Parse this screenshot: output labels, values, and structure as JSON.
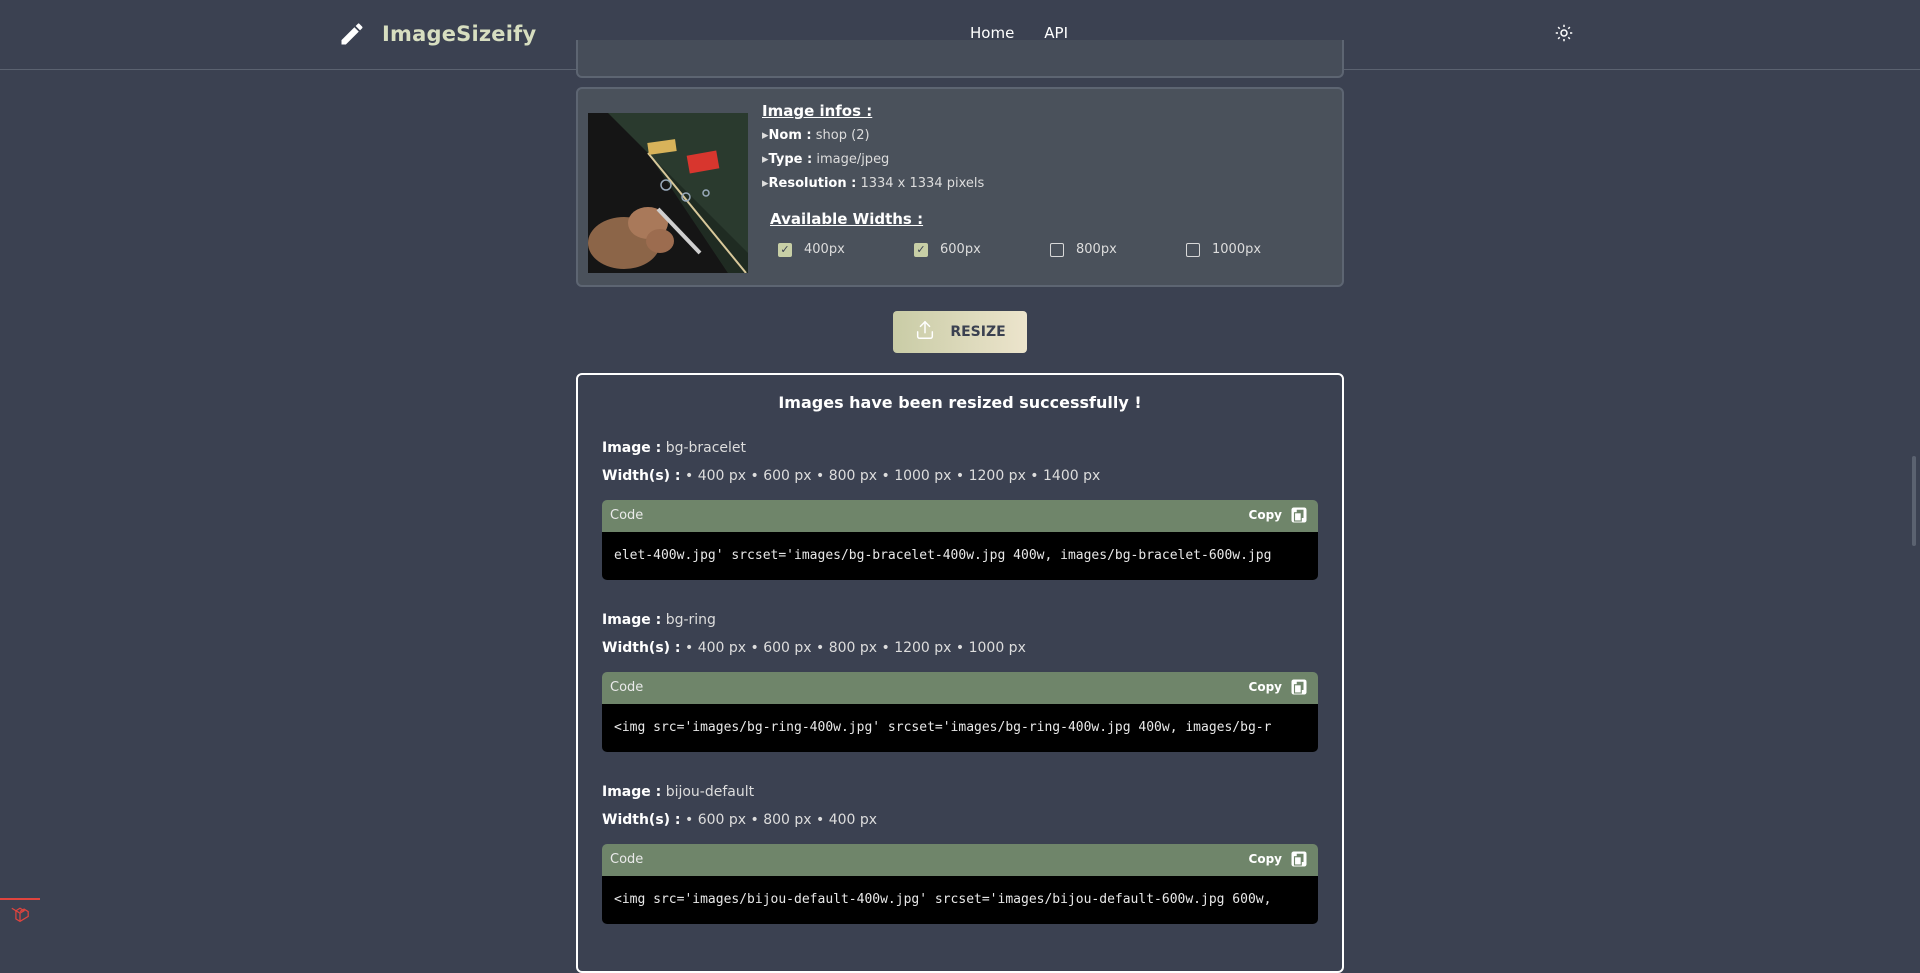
{
  "header": {
    "brand": "ImageSizeify",
    "nav": [
      "Home",
      "API"
    ]
  },
  "info": {
    "title": "Image infos :",
    "name_label": "Nom :",
    "name_value": "shop (2)",
    "type_label": "Type :",
    "type_value": "image/jpeg",
    "resolution_label": "Resolution :",
    "resolution_value": "1334 x 1334 pixels",
    "widths_title": "Available Widths :",
    "widths": [
      {
        "label": "400px",
        "checked": true
      },
      {
        "label": "600px",
        "checked": true
      },
      {
        "label": "800px",
        "checked": false
      },
      {
        "label": "1000px",
        "checked": false
      }
    ]
  },
  "resize_label": "RESIZE",
  "results": {
    "title": "Images have been resized successfully !",
    "image_label": "Image :",
    "widths_label": "Width(s) :",
    "code_label": "Code",
    "copy_label": "Copy",
    "entries": [
      {
        "name": "bg-bracelet",
        "widths": "• 400 px • 600 px • 800 px • 1000 px • 1200 px • 1400 px",
        "code": "elet-400w.jpg' srcset='images/bg-bracelet-400w.jpg 400w, images/bg-bracelet-600w.jpg"
      },
      {
        "name": "bg-ring",
        "widths": "• 400 px • 600 px • 800 px • 1200 px • 1000 px",
        "code": "<img src='images/bg-ring-400w.jpg' srcset='images/bg-ring-400w.jpg 400w, images/bg-r"
      },
      {
        "name": "bijou-default",
        "widths": "• 600 px • 800 px • 400 px",
        "code": "<img src='images/bijou-default-400w.jpg' srcset='images/bijou-default-600w.jpg 600w,"
      }
    ]
  },
  "colors": {
    "background": "#3b4151",
    "accent": "#c8cfa6",
    "code_header": "#6f856a",
    "debug": "#e0443e"
  },
  "icons": [
    "pencil-icon",
    "sun-icon",
    "upload-icon",
    "copy-icon",
    "laravel-icon"
  ]
}
